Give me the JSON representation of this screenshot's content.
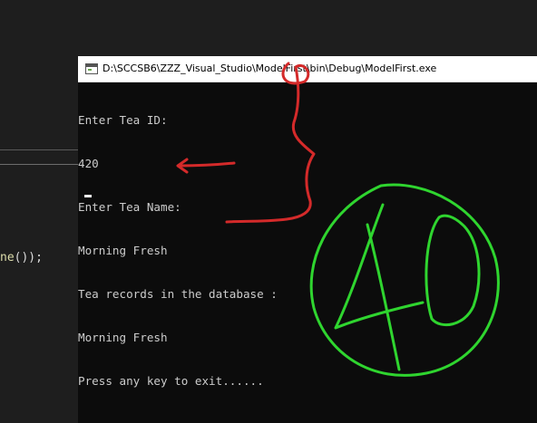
{
  "editor": {
    "code_fragment_method": "ne",
    "code_fragment_tail": "());"
  },
  "console_window": {
    "title": "D:\\SCCSB6\\ZZZ_Visual_Studio\\ModelFirst\\bin\\Debug\\ModelFirst.exe",
    "lines": [
      "Enter Tea ID:",
      "420",
      "Enter Tea Name:",
      "Morning Fresh",
      "Tea records in the database :",
      "Morning Fresh",
      "Press any key to exit......"
    ]
  },
  "annotations": {
    "handwritten_score": "40",
    "colors": {
      "score_ink": "#2fd52f",
      "bracket_ink": "#d42a2a"
    }
  }
}
